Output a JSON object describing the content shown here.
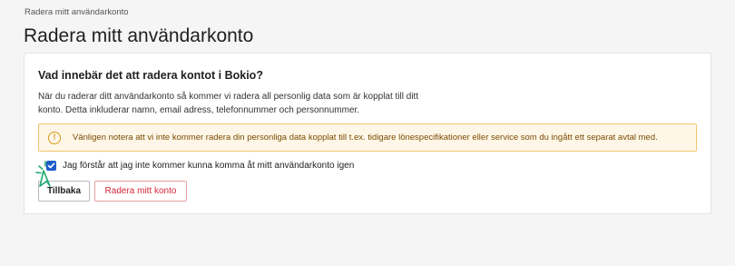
{
  "breadcrumb": {
    "label": "Radera mitt användarkonto"
  },
  "page": {
    "title": "Radera mitt användarkonto"
  },
  "card": {
    "heading": "Vad innebär det att radera kontot i Bokio?",
    "body": "När du raderar ditt användarkonto så kommer vi radera all personlig data som är kopplat till ditt konto. Detta inkluderar namn, email adress, telefonnummer och personnummer.",
    "warning": {
      "icon": "exclamation-circle-icon",
      "icon_glyph": "!",
      "text": "Vänligen notera att vi inte kommer radera din personliga data kopplat till t.ex. tidigare lönespecifikationer eller service som du ingått ett separat avtal med."
    },
    "consent": {
      "checked": true,
      "label": "Jag förstår att jag inte kommer kunna komma åt mitt användarkonto igen"
    },
    "buttons": {
      "back": "Tillbaka",
      "delete": "Radera mitt konto"
    }
  },
  "colors": {
    "accent": "#1f5ccc",
    "warning_border": "#f2c46d",
    "warning_bg": "#fef7e8",
    "danger": "#d6263a",
    "cursor": "#1aa86a"
  }
}
